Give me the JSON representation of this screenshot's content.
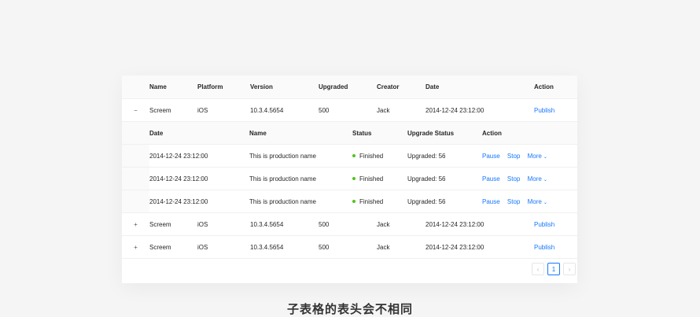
{
  "table": {
    "columns": [
      "Name",
      "Platform",
      "Version",
      "Upgraded",
      "Creator",
      "Date",
      "Action"
    ],
    "rows": [
      {
        "toggle": "−",
        "name": "Screem",
        "platform": "iOS",
        "version": "10.3.4.5654",
        "upgraded": "500",
        "creator": "Jack",
        "date": "2014-12-24 23:12:00",
        "action": "Publish"
      },
      {
        "toggle": "+",
        "name": "Screem",
        "platform": "iOS",
        "version": "10.3.4.5654",
        "upgraded": "500",
        "creator": "Jack",
        "date": "2014-12-24 23:12:00",
        "action": "Publish"
      },
      {
        "toggle": "+",
        "name": "Screem",
        "platform": "iOS",
        "version": "10.3.4.5654",
        "upgraded": "500",
        "creator": "Jack",
        "date": "2014-12-24 23:12:00",
        "action": "Publish"
      }
    ]
  },
  "subtable": {
    "columns": [
      "Date",
      "Name",
      "Status",
      "Upgrade Status",
      "Action"
    ],
    "rows": [
      {
        "date": "2014-12-24 23:12:00",
        "name": "This is production name",
        "status": "Finished",
        "upgrade": "Upgraded: 56",
        "pause": "Pause",
        "stop": "Stop",
        "more": "More"
      },
      {
        "date": "2014-12-24 23:12:00",
        "name": "This is production name",
        "status": "Finished",
        "upgrade": "Upgraded: 56",
        "pause": "Pause",
        "stop": "Stop",
        "more": "More"
      },
      {
        "date": "2014-12-24 23:12:00",
        "name": "This is production name",
        "status": "Finished",
        "upgrade": "Upgraded: 56",
        "pause": "Pause",
        "stop": "Stop",
        "more": "More"
      }
    ],
    "status_color": "#52c41a"
  },
  "pagination": {
    "prev_icon": "‹",
    "current": "1",
    "next_icon": "›"
  },
  "caption": "子表格的表头会不相同",
  "colors": {
    "link": "#1677ff",
    "header_bg": "#fafafa"
  }
}
